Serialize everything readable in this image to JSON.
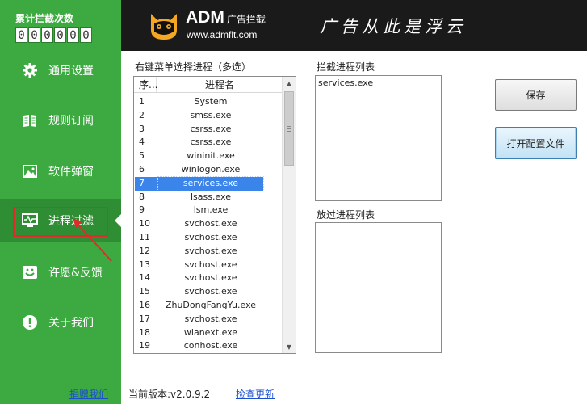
{
  "sidebar": {
    "counter_title": "累计拦截次数",
    "counter_digits": [
      "0",
      "0",
      "0",
      "0",
      "0",
      "0"
    ],
    "items": [
      {
        "label": "通用设置",
        "icon": "gear-icon"
      },
      {
        "label": "规则订阅",
        "icon": "book-icon"
      },
      {
        "label": "软件弹窗",
        "icon": "picture-icon"
      },
      {
        "label": "进程过滤",
        "icon": "monitor-icon",
        "active": true
      },
      {
        "label": "许愿&反馈",
        "icon": "feedback-icon"
      },
      {
        "label": "关于我们",
        "icon": "info-icon"
      }
    ],
    "donate_link": "捐赠我们"
  },
  "header": {
    "logo_title": "ADM",
    "logo_sub": "广告拦截",
    "logo_url": "www.admflt.com",
    "slogan": "广告从此是浮云"
  },
  "process_list": {
    "label": "右键菜单选择进程（多选）",
    "col_index": "序...",
    "col_name": "进程名",
    "selected_index": 6,
    "rows": [
      {
        "idx": "1",
        "name": "System"
      },
      {
        "idx": "2",
        "name": "smss.exe"
      },
      {
        "idx": "3",
        "name": "csrss.exe"
      },
      {
        "idx": "4",
        "name": "csrss.exe"
      },
      {
        "idx": "5",
        "name": "wininit.exe"
      },
      {
        "idx": "6",
        "name": "winlogon.exe"
      },
      {
        "idx": "7",
        "name": "services.exe"
      },
      {
        "idx": "8",
        "name": "lsass.exe"
      },
      {
        "idx": "9",
        "name": "lsm.exe"
      },
      {
        "idx": "10",
        "name": "svchost.exe"
      },
      {
        "idx": "11",
        "name": "svchost.exe"
      },
      {
        "idx": "12",
        "name": "svchost.exe"
      },
      {
        "idx": "13",
        "name": "svchost.exe"
      },
      {
        "idx": "14",
        "name": "svchost.exe"
      },
      {
        "idx": "15",
        "name": "svchost.exe"
      },
      {
        "idx": "16",
        "name": "ZhuDongFangYu.exe"
      },
      {
        "idx": "17",
        "name": "svchost.exe"
      },
      {
        "idx": "18",
        "name": "wlanext.exe"
      },
      {
        "idx": "19",
        "name": "conhost.exe"
      }
    ]
  },
  "block_list": {
    "label": "拦截进程列表",
    "value": "services.exe"
  },
  "allow_list": {
    "label": "放过进程列表",
    "value": ""
  },
  "buttons": {
    "save": "保存",
    "open_config": "打开配置文件"
  },
  "footer": {
    "version": "当前版本:v2.0.9.2",
    "check_update": "检查更新"
  },
  "colors": {
    "sidebar_green": "#3da941",
    "sidebar_active": "#2f8e34",
    "header_black": "#1a1a1a",
    "selection_blue": "#3b84ea",
    "highlight_red": "#e02b2b",
    "link_blue": "#1a4fd0"
  }
}
